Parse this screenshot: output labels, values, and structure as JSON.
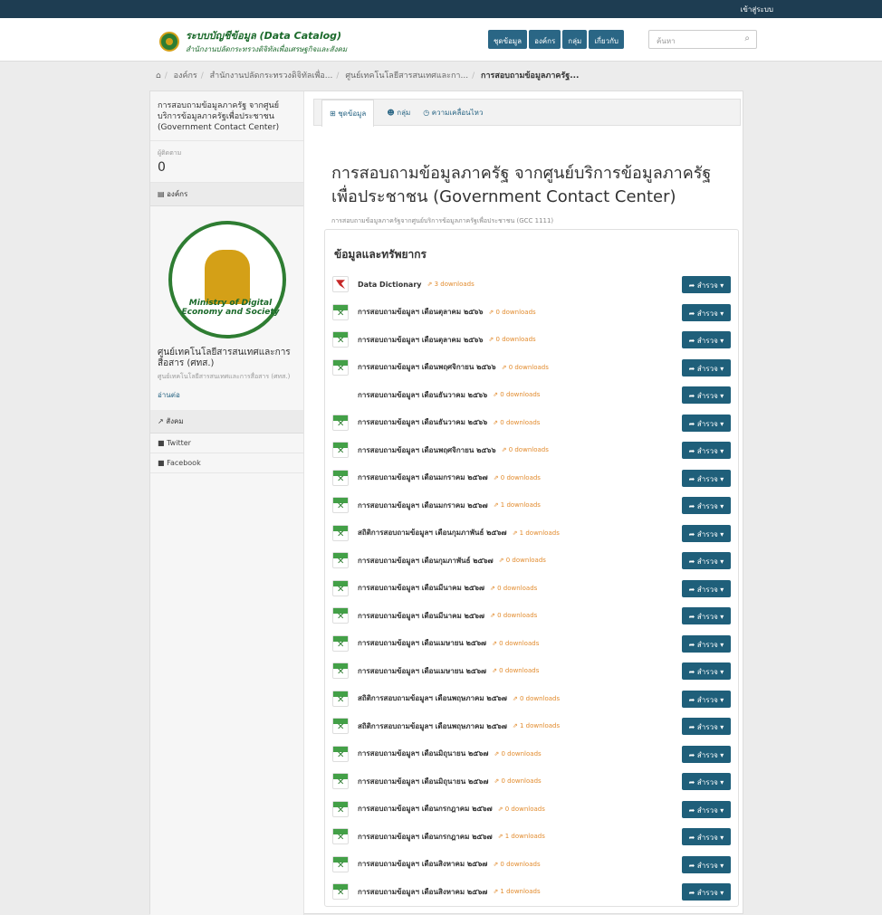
{
  "topbar": {
    "login": "เข้าสู่ระบบ"
  },
  "header": {
    "logo_line1": "ระบบบัญชีข้อมูล (Data Catalog)",
    "logo_line2": "สำนักงานปลัดกระทรวงดิจิทัลเพื่อเศรษฐกิจและสังคม",
    "nav": [
      "ชุดข้อมูล",
      "องค์กร",
      "กลุ่ม",
      "เกี่ยวกับ"
    ],
    "search_placeholder": "ค้นหา"
  },
  "breadcrumb": [
    "องค์กร",
    "สำนักงานปลัดกระทรวงดิจิทัลเพื่อ...",
    "ศูนย์เทคโนโลยีสารสนเทศและกา...",
    "การสอบถามข้อมูลภาครัฐ..."
  ],
  "sidebar": {
    "title": "การสอบถามข้อมูลภาครัฐ จากศูนย์บริการข้อมูลภาครัฐเพื่อประชาชน (Government Contact Center)",
    "followers_label": "ผู้ติดตาม",
    "followers": "0",
    "org_section": "องค์กร",
    "seal_text": "Ministry of Digital Economy and Society",
    "org_name": "ศูนย์เทคโนโลยีสารสนเทศและการสื่อสาร (ศทส.)",
    "org_sub": "ศูนย์เทคโนโลยีสารสนเทศและการสื่อสาร (ศทส.)",
    "read_more": "อ่านต่อ",
    "social_section": "สังคม",
    "social": [
      "Twitter",
      "Facebook"
    ]
  },
  "tabs": [
    "ชุดข้อมูล",
    "กลุ่ม",
    "ความเคลื่อนไหว"
  ],
  "dataset": {
    "title": "การสอบถามข้อมูลภาครัฐ จากศูนย์บริการข้อมูลภาครัฐเพื่อประชาชน (Government Contact Center)",
    "description": "การสอบถามข้อมูลภาครัฐจากศูนย์บริการข้อมูลภาครัฐเพื่อประชาชน (GCC 1111)",
    "resources_heading": "ข้อมูลและทรัพยากร",
    "explore_label": "สำรวจ"
  },
  "resources": [
    {
      "name": "Data Dictionary",
      "downloads": "3 downloads",
      "icon": "pdf"
    },
    {
      "name": "การสอบถามข้อมูลฯ เดือนตุลาคม ๒๕๖๖",
      "downloads": "0 downloads",
      "icon": "xls"
    },
    {
      "name": "การสอบถามข้อมูลฯ เดือนตุลาคม ๒๕๖๖",
      "downloads": "0 downloads",
      "icon": "xls"
    },
    {
      "name": "การสอบถามข้อมูลฯ เดือนพฤศจิกายน ๒๕๖๖",
      "downloads": "0 downloads",
      "icon": "xls"
    },
    {
      "name": "การสอบถามข้อมูลฯ เดือนธันวาคม ๒๕๖๖",
      "downloads": "0 downloads",
      "icon": "none"
    },
    {
      "name": "การสอบถามข้อมูลฯ เดือนธันวาคม ๒๕๖๖",
      "downloads": "0 downloads",
      "icon": "xls"
    },
    {
      "name": "การสอบถามข้อมูลฯ เดือนพฤศจิกายน ๒๕๖๖",
      "downloads": "0 downloads",
      "icon": "xls"
    },
    {
      "name": "การสอบถามข้อมูลฯ เดือนมกราคม ๒๕๖๗",
      "downloads": "0 downloads",
      "icon": "xls"
    },
    {
      "name": "การสอบถามข้อมูลฯ เดือนมกราคม ๒๕๖๗",
      "downloads": "1 downloads",
      "icon": "xls"
    },
    {
      "name": "สถิติการสอบถามข้อมูลฯ เดือนกุมภาพันธ์ ๒๕๖๗",
      "downloads": "1 downloads",
      "icon": "xls"
    },
    {
      "name": "การสอบถามข้อมูลฯ เดือนกุมภาพันธ์ ๒๕๖๗",
      "downloads": "0 downloads",
      "icon": "xls"
    },
    {
      "name": "การสอบถามข้อมูลฯ เดือนมีนาคม ๒๕๖๗",
      "downloads": "0 downloads",
      "icon": "xls"
    },
    {
      "name": "การสอบถามข้อมูลฯ เดือนมีนาคม ๒๕๖๗",
      "downloads": "0 downloads",
      "icon": "xls"
    },
    {
      "name": "การสอบถามข้อมูลฯ เดือนเมษายน ๒๕๖๗",
      "downloads": "0 downloads",
      "icon": "xls"
    },
    {
      "name": "การสอบถามข้อมูลฯ เดือนเมษายน ๒๕๖๗",
      "downloads": "0 downloads",
      "icon": "xls"
    },
    {
      "name": "สถิติการสอบถามข้อมูลฯ เดือนพฤษภาคม ๒๕๖๗",
      "downloads": "0 downloads",
      "icon": "xls"
    },
    {
      "name": "สถิติการสอบถามข้อมูลฯ เดือนพฤษภาคม ๒๕๖๗",
      "downloads": "1 downloads",
      "icon": "xls"
    },
    {
      "name": "การสอบถามข้อมูลฯ เดือนมิถุนายน ๒๕๖๗",
      "downloads": "0 downloads",
      "icon": "xls"
    },
    {
      "name": "การสอบถามข้อมูลฯ เดือนมิถุนายน ๒๕๖๗",
      "downloads": "0 downloads",
      "icon": "xls"
    },
    {
      "name": "การสอบถามข้อมูลฯ เดือนกรกฎาคม ๒๕๖๗",
      "downloads": "0 downloads",
      "icon": "xls"
    },
    {
      "name": "การสอบถามข้อมูลฯ เดือนกรกฎาคม ๒๕๖๗",
      "downloads": "1 downloads",
      "icon": "xls"
    },
    {
      "name": "การสอบถามข้อมูลฯ เดือนสิงหาคม ๒๕๖๗",
      "downloads": "0 downloads",
      "icon": "xls"
    },
    {
      "name": "การสอบถามข้อมูลฯ เดือนสิงหาคม ๒๕๖๗",
      "downloads": "1 downloads",
      "icon": "xls"
    }
  ]
}
